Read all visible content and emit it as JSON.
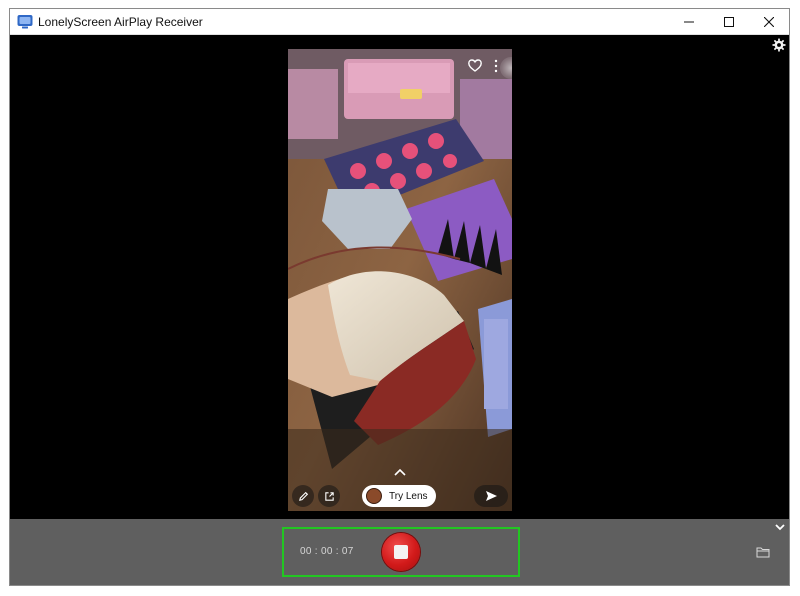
{
  "window": {
    "title": "LonelyScreen AirPlay Receiver",
    "icons": {
      "app": "monitor-icon",
      "minimize": "minimize-icon",
      "maximize": "maximize-icon",
      "close": "close-icon",
      "settings": "gear-icon"
    }
  },
  "video": {
    "overlay": {
      "try_lens_label": "Try Lens",
      "icons": [
        "heart-icon",
        "more-dots-icon",
        "chevron-up-icon",
        "pencil-icon",
        "share-icon",
        "send-icon"
      ]
    }
  },
  "toolbar": {
    "timer": "00 : 00 : 07",
    "icons": [
      "chevron-down-icon",
      "stop-record-icon",
      "folder-icon"
    ]
  },
  "colors": {
    "accent_highlight": "#22c722",
    "record_red": "#d21a1a",
    "toolbar_bg": "#5f5f5f",
    "stage_bg": "#000000"
  }
}
